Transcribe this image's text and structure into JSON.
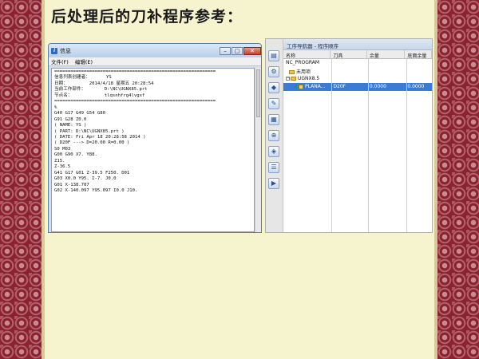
{
  "slide": {
    "title": "后处理后的刀补程序参考："
  },
  "info_window": {
    "title": "信息",
    "menu": [
      "文件(F)",
      "编辑(E)"
    ],
    "buttons": {
      "minimize": "–",
      "maximize": "□",
      "close": "✕"
    },
    "lines": [
      "============================================================",
      "信息列表创建者：      YS",
      "日期：        2014/4/18 星期五 20:28:54",
      "当前工作部件：       D:\\NC\\UGNX85.prt",
      "节点名：            tlqsnhfrg4lvgxf",
      "============================================================",
      "%",
      "G40 G17 G49 G54 G80",
      "G91 G28 Z0.0",
      "( NAME: YS )",
      "( PART: D:\\NC\\UGNX85.prt )",
      "( DATE: Fri Apr 18 20:28:58 2014 )",
      "( D20F ---> D=20.00 R=0.00 )",
      "S0 M03",
      "G00 G90 X7. Y88.",
      "Z15.",
      "Z-36.5",
      "G41 G17 G01 Z-39.5 F250. D01",
      "G03 X0.0 Y95. I-7. J0.0",
      "G01 X-138.707",
      "G02 X-140.097 Y95.097 I0.0 J10."
    ]
  },
  "navigator": {
    "title": "工序导航器 - 程序顺序",
    "columns": [
      "名称",
      "刀具",
      "余量",
      "底面余量"
    ],
    "tree": [
      {
        "name": "NC_PROGRAM",
        "tool": "",
        "stock": "",
        "floor": ""
      },
      {
        "name": "未用项",
        "tool": "",
        "stock": "",
        "floor": ""
      },
      {
        "name": "UGNX8.5",
        "tool": "",
        "stock": "",
        "floor": ""
      },
      {
        "name": "PLANA...",
        "tool": "D20F",
        "stock": "0.0000",
        "floor": "0.0000"
      }
    ],
    "toolbar_icons": [
      "program-order-icon",
      "machine-tool-icon",
      "geometry-icon",
      "method-icon",
      "create-program-icon",
      "create-tool-icon",
      "create-geometry-icon",
      "create-method-icon",
      "create-operation-icon"
    ]
  },
  "colors": {
    "background": "#f6f3cf",
    "border": "#8a2230",
    "selection": "#3a7bd5"
  }
}
